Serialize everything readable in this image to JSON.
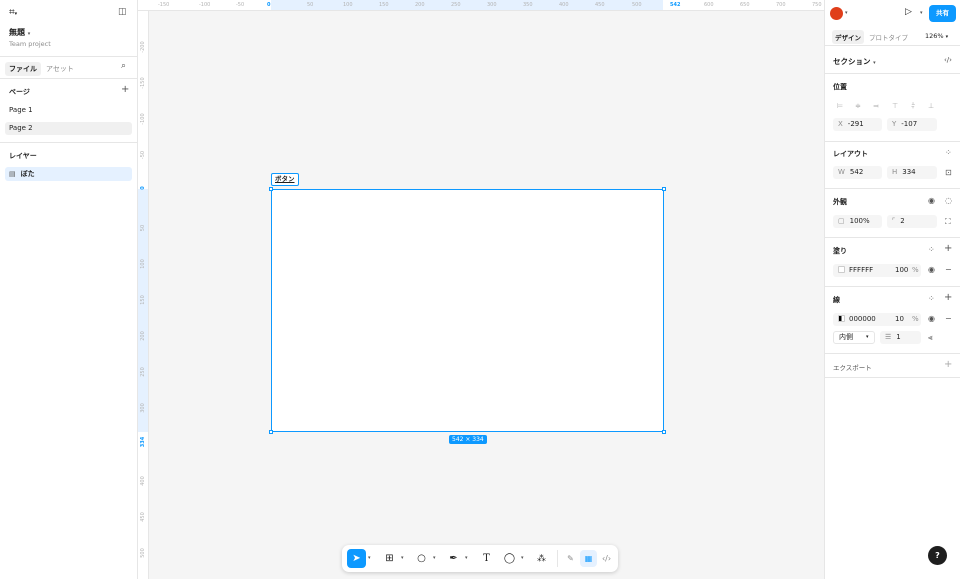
{
  "left_panel": {
    "file_name": "無題",
    "project": "Team project",
    "tabs": [
      "ファイル",
      "アセット"
    ],
    "pages_header": "ページ",
    "pages": [
      "Page 1",
      "Page 2"
    ],
    "layers_header": "レイヤー",
    "layers": [
      "ぼた"
    ]
  },
  "rulers": {
    "top": [
      {
        "label": "-150",
        "highlight": false
      },
      {
        "label": "-100",
        "highlight": false
      },
      {
        "label": "-50",
        "highlight": false
      },
      {
        "label": "0",
        "highlight": true
      },
      {
        "label": "50",
        "highlight": false
      },
      {
        "label": "100",
        "highlight": false
      },
      {
        "label": "150",
        "highlight": false
      },
      {
        "label": "200",
        "highlight": false
      },
      {
        "label": "250",
        "highlight": false
      },
      {
        "label": "300",
        "highlight": false
      },
      {
        "label": "350",
        "highlight": false
      },
      {
        "label": "400",
        "highlight": false
      },
      {
        "label": "450",
        "highlight": false
      },
      {
        "label": "500",
        "highlight": false
      },
      {
        "label": "542",
        "highlight": true
      },
      {
        "label": "600",
        "highlight": false
      },
      {
        "label": "650",
        "highlight": false
      },
      {
        "label": "700",
        "highlight": false
      },
      {
        "label": "750",
        "highlight": false
      }
    ],
    "left": [
      {
        "label": "-200",
        "highlight": false
      },
      {
        "label": "-150",
        "highlight": false
      },
      {
        "label": "-100",
        "highlight": false
      },
      {
        "label": "-50",
        "highlight": false
      },
      {
        "label": "0",
        "highlight": true
      },
      {
        "label": "50",
        "highlight": false
      },
      {
        "label": "100",
        "highlight": false
      },
      {
        "label": "150",
        "highlight": false
      },
      {
        "label": "200",
        "highlight": false
      },
      {
        "label": "250",
        "highlight": false
      },
      {
        "label": "300",
        "highlight": false
      },
      {
        "label": "334",
        "highlight": true
      },
      {
        "label": "400",
        "highlight": false
      },
      {
        "label": "450",
        "highlight": false
      },
      {
        "label": "500",
        "highlight": false
      }
    ]
  },
  "canvas": {
    "frame_label": "ボタン",
    "size_badge": "542 × 334"
  },
  "right_panel": {
    "share": "共有",
    "tabs": [
      "デザイン",
      "プロトタイプ"
    ],
    "zoom": "126%",
    "selection_type": "セクション",
    "position": {
      "title": "位置",
      "x_label": "X",
      "x": "-291",
      "y_label": "Y",
      "y": "-107"
    },
    "layout": {
      "title": "レイアウト",
      "w_label": "W",
      "w": "542",
      "h_label": "H",
      "h": "334"
    },
    "appearance": {
      "title": "外観",
      "opacity": "100%",
      "radius": "2"
    },
    "fill": {
      "title": "塗り",
      "color": "FFFFFF",
      "opacity": "100",
      "unit": "%"
    },
    "stroke": {
      "title": "線",
      "color": "000000",
      "opacity": "10",
      "unit": "%",
      "position": "内側",
      "weight": "1"
    },
    "export": {
      "title": "エクスポート"
    }
  },
  "help": "?",
  "colors": {
    "accent": "#0d99ff",
    "avatar": "#e03e1a"
  }
}
